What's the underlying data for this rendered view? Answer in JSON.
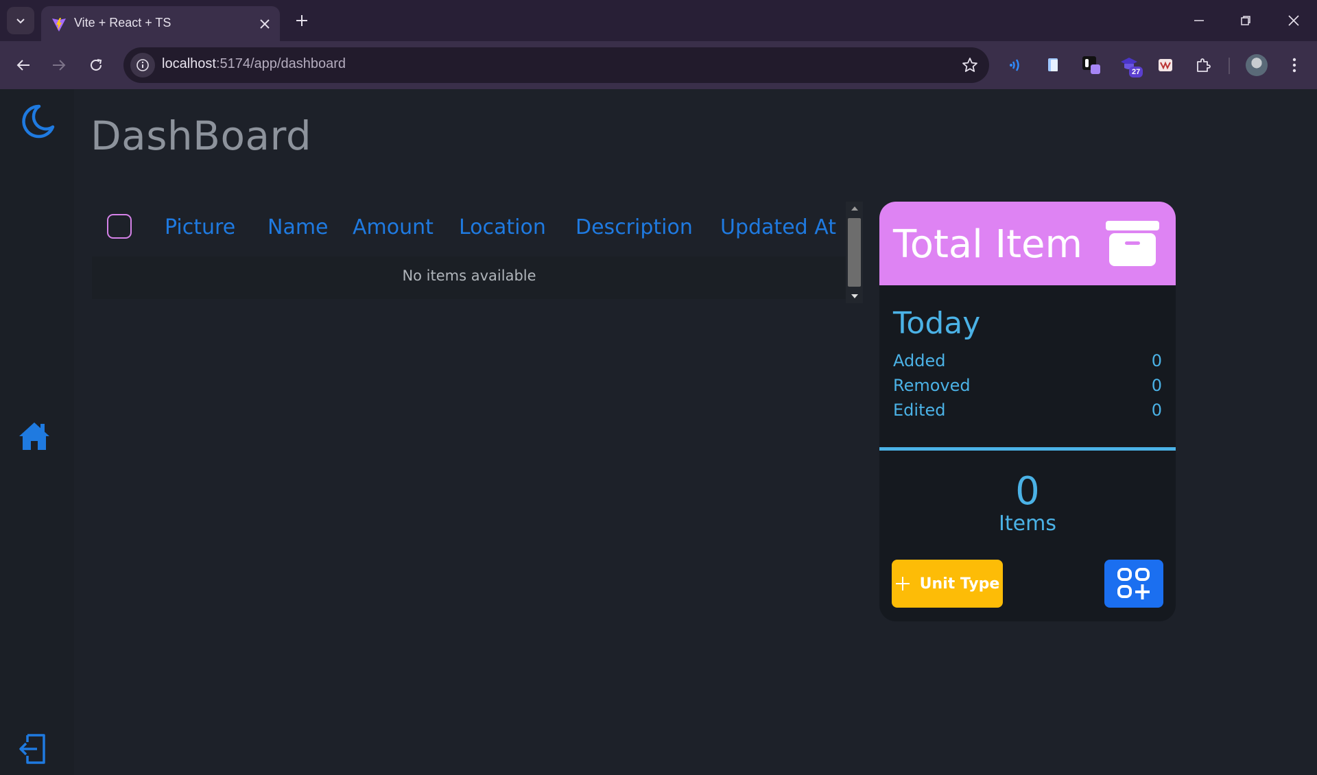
{
  "browser": {
    "tab_title": "Vite + React + TS",
    "url_host": "localhost",
    "url_path": ":5174/app/dashboard",
    "extension_badge": "27"
  },
  "sidebar": {
    "theme_icon": "moon-icon",
    "home_icon": "home-icon",
    "logout_icon": "logout-icon",
    "accent": "#1f7ae0"
  },
  "page": {
    "title": "DashBoard"
  },
  "table": {
    "columns": [
      "Picture",
      "Name",
      "Amount",
      "Location",
      "Description",
      "Updated At"
    ],
    "empty_message": "No items available",
    "header_color": "#1f7ae0"
  },
  "summary_card": {
    "title": "Total Item",
    "header_color": "#de83f3",
    "today_heading": "Today",
    "stats": [
      {
        "label": "Added",
        "value": "0"
      },
      {
        "label": "Removed",
        "value": "0"
      },
      {
        "label": "Edited",
        "value": "0"
      }
    ],
    "total_count": "0",
    "total_label": "Items",
    "unit_type_button": "Unit Type",
    "unit_type_color": "#fdbc07",
    "add_button_color": "#1b6ff0",
    "text_color": "#4bb2e6"
  }
}
